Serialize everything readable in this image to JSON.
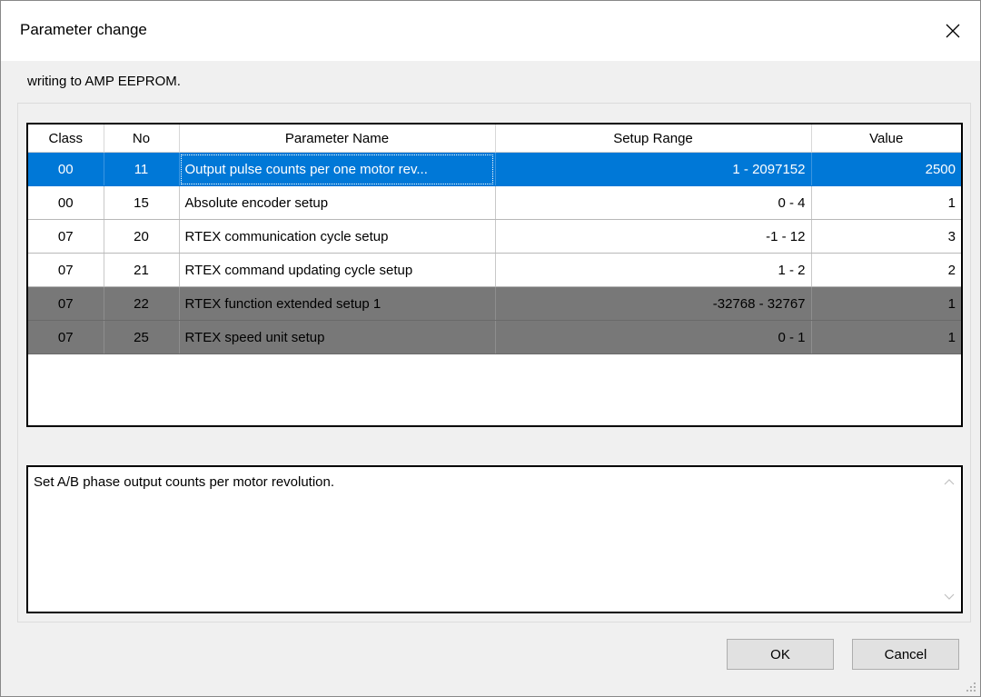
{
  "window": {
    "title": "Parameter change",
    "close_icon": "close-icon"
  },
  "message": "writing to AMP EEPROM.",
  "table": {
    "headers": [
      "Class",
      "No",
      "Parameter Name",
      "Setup Range",
      "Value"
    ],
    "rows": [
      {
        "class": "00",
        "no": "11",
        "name": "Output pulse counts per one motor rev...",
        "range": "1 - 2097152",
        "value": "2500",
        "state": "selected"
      },
      {
        "class": "00",
        "no": "15",
        "name": "Absolute encoder setup",
        "range": "0 - 4",
        "value": "1",
        "state": "normal"
      },
      {
        "class": "07",
        "no": "20",
        "name": "RTEX communication cycle setup",
        "range": "-1 - 12",
        "value": "3",
        "state": "normal"
      },
      {
        "class": "07",
        "no": "21",
        "name": "RTEX command updating cycle setup",
        "range": "1 - 2",
        "value": "2",
        "state": "normal"
      },
      {
        "class": "07",
        "no": "22",
        "name": "RTEX function extended setup 1",
        "range": "-32768 - 32767",
        "value": "1",
        "state": "disabled"
      },
      {
        "class": "07",
        "no": "25",
        "name": "RTEX speed unit setup",
        "range": "0 - 1",
        "value": "1",
        "state": "disabled"
      }
    ]
  },
  "description": {
    "text": "Set A/B phase output counts per motor revolution.",
    "scroll_up_icon": "chevron-up-icon",
    "scroll_down_icon": "chevron-down-icon"
  },
  "buttons": {
    "ok": "OK",
    "cancel": "Cancel"
  },
  "colors": {
    "selected_row": "#0078d7",
    "disabled_row": "#787878",
    "dialog_background": "#f0f0f0"
  }
}
